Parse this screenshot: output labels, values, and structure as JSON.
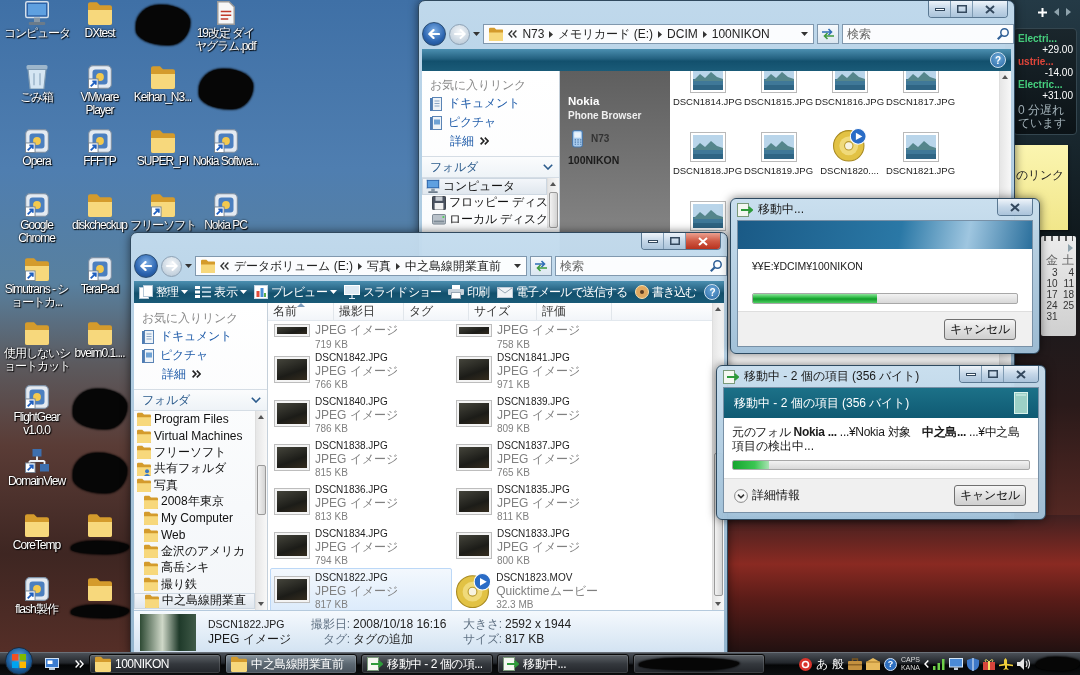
{
  "desktop": {
    "columns": [
      [
        {
          "label": "コンピュータ",
          "kind": "computer",
          "shortcut": false,
          "redacted": false
        },
        {
          "label": "ごみ箱",
          "kind": "trash",
          "shortcut": false,
          "redacted": false
        },
        {
          "label": "Opera",
          "kind": "app",
          "shortcut": true,
          "redacted": false
        },
        {
          "label": "Google Chrome",
          "kind": "app",
          "shortcut": true,
          "redacted": false
        },
        {
          "label": "Simutrans - ショートカ...",
          "kind": "folder",
          "shortcut": true,
          "redacted": false
        },
        {
          "label": "使用しないショートカット",
          "kind": "folder",
          "shortcut": false,
          "redacted": false
        },
        {
          "label": "FlightGear v1.0.0",
          "kind": "app",
          "shortcut": true,
          "redacted": false
        },
        {
          "label": "DomainView",
          "kind": "network",
          "shortcut": true,
          "redacted": false
        },
        {
          "label": "CoreTemp",
          "kind": "folder",
          "shortcut": false,
          "redacted": false
        },
        {
          "label": "flash製作",
          "kind": "app",
          "shortcut": true,
          "redacted": false
        }
      ],
      [
        {
          "label": "DXtest",
          "kind": "folder",
          "shortcut": false,
          "redacted": false
        },
        {
          "label": "VMware Player",
          "kind": "app",
          "shortcut": true,
          "redacted": false
        },
        {
          "label": "FFFTP",
          "kind": "app",
          "shortcut": true,
          "redacted": false
        },
        {
          "label": "diskcheckup",
          "kind": "folder",
          "shortcut": false,
          "redacted": false
        },
        {
          "label": "TeraPad",
          "kind": "app",
          "shortcut": true,
          "redacted": false
        },
        {
          "label": "bveim0.1....",
          "kind": "folder",
          "shortcut": false,
          "redacted": false
        },
        {
          "kind": "blot"
        },
        {
          "kind": "blot"
        },
        {
          "kind": "folder",
          "shortcut": false,
          "redacted": true
        },
        {
          "kind": "folder",
          "shortcut": false,
          "redacted": true
        }
      ],
      [
        {
          "kind": "blot"
        },
        {
          "label": "Keihan_N3...",
          "kind": "folder",
          "shortcut": false,
          "redacted": false
        },
        {
          "label": "SUPER_PI",
          "kind": "folder",
          "shortcut": false,
          "redacted": false
        },
        {
          "label": "フリーソフト",
          "kind": "folder",
          "shortcut": true,
          "redacted": false
        }
      ],
      [
        {
          "label": "19改定 ダイヤグラム.pdf",
          "kind": "document",
          "shortcut": false,
          "redacted": false
        },
        {
          "kind": "blot"
        },
        {
          "label": "Nokia Softwa...",
          "kind": "app",
          "shortcut": true,
          "redacted": false
        },
        {
          "label": "Nokia PC",
          "kind": "app",
          "shortcut": true,
          "redacted": false
        }
      ]
    ]
  },
  "gadgets": {
    "stocks": [
      {
        "name": "Electri...",
        "change": "+29.00",
        "color": "#46d17e"
      },
      {
        "name": "ustrie...",
        "change": "-14.00",
        "color": "#e0453a"
      },
      {
        "name": "Electric...",
        "change": "+31.00",
        "color": "#46d17e"
      }
    ],
    "stock_note": "0 分遅れています",
    "note": "のリンク",
    "calendar": {
      "weekdays": [
        "金",
        "土"
      ],
      "weeks": [
        [
          "3",
          "4"
        ],
        [
          "10",
          "11"
        ],
        [
          "17",
          "18"
        ],
        [
          "24",
          "25"
        ],
        [
          "31"
        ]
      ]
    }
  },
  "windows": [
    {
      "kind": "phone_browser",
      "active": false,
      "address": {
        "crumbs": [
          "N73",
          "メモリカード (E:)",
          "DCIM",
          "100NIKON"
        ]
      },
      "search": {
        "placeholder": "検索"
      },
      "help": "?",
      "favorites": {
        "title": "お気に入りリンク",
        "links": [
          {
            "label": "ドキュメント",
            "kind": "documents"
          },
          {
            "label": "ピクチャ",
            "kind": "pictures"
          }
        ],
        "more": "詳細"
      },
      "folders": {
        "title": "フォルダ",
        "tree": [
          {
            "label": "コンピュータ",
            "kind": "computer",
            "selected": true,
            "children": [
              {
                "label": "フロッピー ディス",
                "kind": "floppy",
                "selected": false
              },
              {
                "label": "ローカル ディスク",
                "kind": "disk",
                "selected": false
              }
            ]
          }
        ]
      },
      "device": {
        "title": "Nokia",
        "subtitle": "Phone Browser",
        "model": "N73",
        "folder": "100NIKON"
      },
      "files": [
        {
          "name": "DSCN1814.JPG",
          "kind": "image"
        },
        {
          "name": "DSCN1815.JPG",
          "kind": "image"
        },
        {
          "name": "DSCN1816.JPG",
          "kind": "image"
        },
        {
          "name": "DSCN1817.JPG",
          "kind": "image"
        },
        {
          "name": "DSCN1818.JPG",
          "kind": "image"
        },
        {
          "name": "DSCN1819.JPG",
          "kind": "image"
        },
        {
          "name": "DSCN1820....",
          "kind": "video"
        },
        {
          "name": "DSCN1821.JPG",
          "kind": "image"
        },
        {
          "kind": "image"
        }
      ]
    },
    {
      "kind": "folder_view",
      "active": true,
      "address": {
        "crumbs": [
          "データボリューム (E:)",
          "写真",
          "中之島線開業直前"
        ]
      },
      "search": {
        "placeholder": "検索"
      },
      "help": "?",
      "toolbar": [
        {
          "label": "整理",
          "kind": "organize",
          "menu": true
        },
        {
          "label": "表示",
          "kind": "views",
          "menu": true
        },
        {
          "label": "プレビュー",
          "kind": "preview",
          "menu": true
        },
        {
          "label": "スライドショー",
          "kind": "slideshow",
          "menu": false
        },
        {
          "label": "印刷",
          "kind": "print",
          "menu": false
        },
        {
          "label": "電子メールで送信する",
          "kind": "email",
          "menu": false
        },
        {
          "label": "書き込む",
          "kind": "burn",
          "menu": false
        }
      ],
      "favorites": {
        "title": "お気に入りリンク",
        "links": [
          {
            "label": "ドキュメント",
            "kind": "documents"
          },
          {
            "label": "ピクチャ",
            "kind": "pictures"
          }
        ],
        "more": "詳細"
      },
      "folders": {
        "title": "フォルダ",
        "tree": [
          {
            "label": "Program Files",
            "kind": "folder",
            "selected": false
          },
          {
            "label": "Virtual Machines",
            "kind": "folder",
            "selected": false
          },
          {
            "label": "フリーソフト",
            "kind": "folder",
            "selected": false
          },
          {
            "label": "共有フォルダ",
            "kind": "shared",
            "selected": false
          },
          {
            "label": "写真",
            "kind": "folder",
            "selected": false,
            "children": [
              {
                "label": "2008年東京",
                "kind": "folder",
                "selected": false
              },
              {
                "label": "My Computer",
                "kind": "folder",
                "selected": false
              },
              {
                "label": "Web",
                "kind": "folder",
                "selected": false
              },
              {
                "label": "金沢のアメリカ",
                "kind": "folder",
                "selected": false
              },
              {
                "label": "高岳シキ",
                "kind": "folder",
                "selected": false
              },
              {
                "label": "撮り鉄",
                "kind": "folder",
                "selected": false
              },
              {
                "label": "中之島線開業直",
                "kind": "folder",
                "selected": true
              }
            ]
          }
        ]
      },
      "columns": [
        {
          "label": "名前",
          "sorted": true
        },
        {
          "label": "撮影日",
          "sorted": false
        },
        {
          "label": "タグ",
          "sorted": false
        },
        {
          "label": "サイズ",
          "sorted": false
        },
        {
          "label": "評価",
          "sorted": false
        }
      ],
      "files": [
        {
          "type": "JPEG イメージ",
          "size": "719 KB",
          "kind": "photo",
          "selected": false
        },
        {
          "type": "JPEG イメージ",
          "size": "758 KB",
          "kind": "photo",
          "selected": false
        },
        {
          "name": "DSCN1842.JPG",
          "type": "JPEG イメージ",
          "size": "766 KB",
          "kind": "photo",
          "selected": false
        },
        {
          "name": "DSCN1841.JPG",
          "type": "JPEG イメージ",
          "size": "971 KB",
          "kind": "photo",
          "selected": false
        },
        {
          "name": "DSCN1840.JPG",
          "type": "JPEG イメージ",
          "size": "786 KB",
          "kind": "photo",
          "selected": false
        },
        {
          "name": "DSCN1839.JPG",
          "type": "JPEG イメージ",
          "size": "809 KB",
          "kind": "photo",
          "selected": false
        },
        {
          "name": "DSCN1838.JPG",
          "type": "JPEG イメージ",
          "size": "815 KB",
          "kind": "photo",
          "selected": false
        },
        {
          "name": "DSCN1837.JPG",
          "type": "JPEG イメージ",
          "size": "765 KB",
          "kind": "photo",
          "selected": false
        },
        {
          "name": "DSCN1836.JPG",
          "type": "JPEG イメージ",
          "size": "813 KB",
          "kind": "photo",
          "selected": false
        },
        {
          "name": "DSCN1835.JPG",
          "type": "JPEG イメージ",
          "size": "811 KB",
          "kind": "photo",
          "selected": false
        },
        {
          "name": "DSCN1834.JPG",
          "type": "JPEG イメージ",
          "size": "794 KB",
          "kind": "photo",
          "selected": false
        },
        {
          "name": "DSCN1833.JPG",
          "type": "JPEG イメージ",
          "size": "800 KB",
          "kind": "photo",
          "selected": false
        },
        {
          "name": "DSCN1822.JPG",
          "type": "JPEG イメージ",
          "size": "817 KB",
          "kind": "photo",
          "selected": true
        },
        {
          "name": "DSCN1823.MOV",
          "type": "Quicktimeムービー",
          "size": "32.3 MB",
          "kind": "video",
          "selected": false
        }
      ],
      "details": {
        "name": "DSCN1822.JPG",
        "type": "JPEG イメージ",
        "fields": [
          {
            "label": "撮影日:",
            "value": "2008/10/18 16:16"
          },
          {
            "label": "大きさ:",
            "value": "2592 x 1944"
          },
          {
            "label": "タグ:",
            "value": "タグの追加"
          },
          {
            "label": "サイズ:",
            "value": "817 KB"
          }
        ]
      }
    }
  ],
  "dialogs": [
    {
      "kind": "compact",
      "title": "移動中...",
      "path": "¥¥E:¥DCIM¥100NIKON",
      "level": 0.47,
      "cancel": "キャンセル"
    },
    {
      "kind": "detailed",
      "title": "移動中 - 2 個の項目 (356 バイト)",
      "heading": "移動中 - 2 個の項目 (356 バイト)",
      "details": [
        {
          "text": "元のフォル",
          "bold": false
        },
        {
          "text": "Nokia ...",
          "bold": true
        },
        {
          "text": "...¥Nokia",
          "bold": false
        },
        {
          "text": "対象",
          "bold": false
        },
        {
          "text": "中之島...",
          "bold": true
        },
        {
          "text": "...¥中之島",
          "bold": false
        }
      ],
      "status": "項目の検出中...",
      "level": 0.12,
      "more": "詳細情報",
      "cancel": "キャンセル"
    }
  ],
  "taskbar": {
    "buttons": [
      {
        "label": "100NIKON",
        "kind": "folder",
        "selected": false
      },
      {
        "label": "中之島線開業直前",
        "kind": "folder",
        "selected": true
      },
      {
        "label": "移動中 - 2 個の項...",
        "kind": "transfer",
        "selected": false
      },
      {
        "label": "移動中...",
        "kind": "transfer",
        "selected": false
      },
      {
        "kind": "redacted",
        "selected": false
      }
    ],
    "ime": [
      "あ",
      "般"
    ],
    "help": "?",
    "locks": [
      "CAPS",
      "KANA"
    ]
  }
}
